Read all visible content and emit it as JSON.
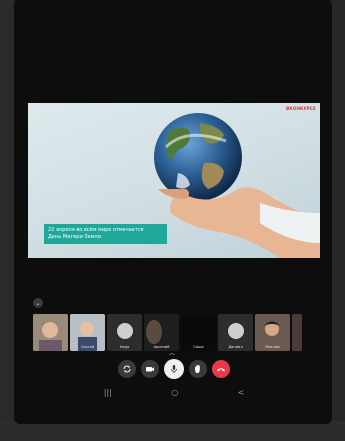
{
  "status_bar": {
    "center": ""
  },
  "slide": {
    "logo": "ВКОНКУРСЕ",
    "caption_line1": "22 апреля во всём мире отмечается",
    "caption_line2": "День Матери-Земли."
  },
  "participants": [
    {
      "name": "",
      "kind": "video"
    },
    {
      "name": "Сергей",
      "kind": "video"
    },
    {
      "name": "Надя",
      "kind": "avatar"
    },
    {
      "name": "Арсений",
      "kind": "video"
    },
    {
      "name": "Саша",
      "kind": "dark"
    },
    {
      "name": "Даниил",
      "kind": "avatar"
    },
    {
      "name": "Максим",
      "kind": "video"
    },
    {
      "name": "",
      "kind": "partial"
    }
  ],
  "controls": {
    "flip_camera": "camera-flip-icon",
    "video": "video-camera-icon",
    "mic": "microphone-icon",
    "raise_hand": "hand-icon",
    "end_call": "phone-hangup-icon",
    "end_color": "#e8394a"
  },
  "navbar": {
    "recents": "|||",
    "home": "○",
    "back": "<"
  }
}
